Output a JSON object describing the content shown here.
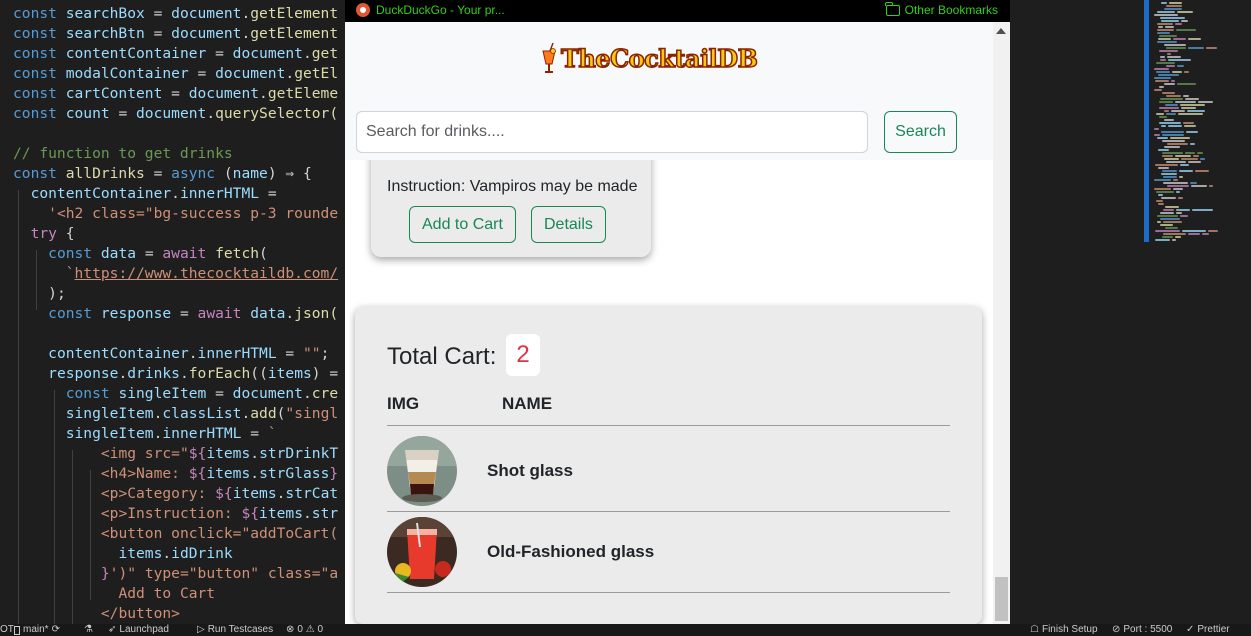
{
  "editor": {
    "lines": [
      [
        {
          "t": "const ",
          "c": "kw"
        },
        {
          "t": "searchBox",
          "c": "var"
        },
        {
          "t": " = ",
          "c": ""
        },
        {
          "t": "document",
          "c": "var"
        },
        {
          "t": ".",
          "c": ""
        },
        {
          "t": "getElement",
          "c": "fn"
        }
      ],
      [
        {
          "t": "const ",
          "c": "kw"
        },
        {
          "t": "searchBtn",
          "c": "var"
        },
        {
          "t": " = ",
          "c": ""
        },
        {
          "t": "document",
          "c": "var"
        },
        {
          "t": ".",
          "c": ""
        },
        {
          "t": "getElement",
          "c": "fn"
        }
      ],
      [
        {
          "t": "const ",
          "c": "kw"
        },
        {
          "t": "contentContainer",
          "c": "var"
        },
        {
          "t": " = ",
          "c": ""
        },
        {
          "t": "document",
          "c": "var"
        },
        {
          "t": ".",
          "c": ""
        },
        {
          "t": "get",
          "c": "fn"
        }
      ],
      [
        {
          "t": "const ",
          "c": "kw"
        },
        {
          "t": "modalContainer",
          "c": "var"
        },
        {
          "t": " = ",
          "c": ""
        },
        {
          "t": "document",
          "c": "var"
        },
        {
          "t": ".",
          "c": ""
        },
        {
          "t": "getEl",
          "c": "fn"
        }
      ],
      [
        {
          "t": "const ",
          "c": "kw"
        },
        {
          "t": "cartContent",
          "c": "var"
        },
        {
          "t": " = ",
          "c": ""
        },
        {
          "t": "document",
          "c": "var"
        },
        {
          "t": ".",
          "c": ""
        },
        {
          "t": "getEleme",
          "c": "fn"
        }
      ],
      [
        {
          "t": "const ",
          "c": "kw"
        },
        {
          "t": "count",
          "c": "var"
        },
        {
          "t": " = ",
          "c": ""
        },
        {
          "t": "document",
          "c": "var"
        },
        {
          "t": ".",
          "c": ""
        },
        {
          "t": "querySelector(",
          "c": "fn"
        }
      ],
      [],
      [
        {
          "t": "// function to get drinks",
          "c": "cm"
        }
      ],
      [
        {
          "t": "const ",
          "c": "kw"
        },
        {
          "t": "allDrinks",
          "c": "fn"
        },
        {
          "t": " = ",
          "c": ""
        },
        {
          "t": "async ",
          "c": "kw"
        },
        {
          "t": "(",
          "c": ""
        },
        {
          "t": "name",
          "c": "var"
        },
        {
          "t": ") ⇒ {",
          "c": ""
        }
      ],
      [
        {
          "t": "  "
        },
        {
          "t": "contentContainer",
          "c": "var"
        },
        {
          "t": ".",
          "c": ""
        },
        {
          "t": "innerHTML",
          "c": "var"
        },
        {
          "t": " =",
          "c": ""
        }
      ],
      [
        {
          "t": "    "
        },
        {
          "t": "'<h2 class=\"bg-success p-3 rounde",
          "c": "str"
        }
      ],
      [
        {
          "t": "  "
        },
        {
          "t": "try ",
          "c": "ctl"
        },
        {
          "t": "{",
          "c": ""
        }
      ],
      [
        {
          "t": "    "
        },
        {
          "t": "const ",
          "c": "kw"
        },
        {
          "t": "data",
          "c": "var"
        },
        {
          "t": " = ",
          "c": ""
        },
        {
          "t": "await ",
          "c": "ctl"
        },
        {
          "t": "fetch",
          "c": "fn"
        },
        {
          "t": "(",
          "c": ""
        }
      ],
      [
        {
          "t": "      "
        },
        {
          "t": "`",
          "c": "str"
        },
        {
          "t": "https://www.thecocktaildb.com/",
          "c": "url"
        }
      ],
      [
        {
          "t": "    "
        },
        {
          "t": ");",
          "c": ""
        }
      ],
      [
        {
          "t": "    "
        },
        {
          "t": "const ",
          "c": "kw"
        },
        {
          "t": "response",
          "c": "var"
        },
        {
          "t": " = ",
          "c": ""
        },
        {
          "t": "await ",
          "c": "ctl"
        },
        {
          "t": "data",
          "c": "var"
        },
        {
          "t": ".",
          "c": ""
        },
        {
          "t": "json(",
          "c": "fn"
        }
      ],
      [],
      [
        {
          "t": "    "
        },
        {
          "t": "contentContainer",
          "c": "var"
        },
        {
          "t": ".",
          "c": ""
        },
        {
          "t": "innerHTML",
          "c": "var"
        },
        {
          "t": " = ",
          "c": ""
        },
        {
          "t": "\"\"",
          "c": "str"
        },
        {
          "t": ";",
          "c": ""
        }
      ],
      [
        {
          "t": "    "
        },
        {
          "t": "response",
          "c": "var"
        },
        {
          "t": ".",
          "c": ""
        },
        {
          "t": "drinks",
          "c": "var"
        },
        {
          "t": ".",
          "c": ""
        },
        {
          "t": "forEach",
          "c": "fn"
        },
        {
          "t": "((",
          "c": ""
        },
        {
          "t": "items",
          "c": "var"
        },
        {
          "t": ") =",
          "c": ""
        }
      ],
      [
        {
          "t": "      "
        },
        {
          "t": "const ",
          "c": "kw"
        },
        {
          "t": "singleItem",
          "c": "var"
        },
        {
          "t": " = ",
          "c": ""
        },
        {
          "t": "document",
          "c": "var"
        },
        {
          "t": ".",
          "c": ""
        },
        {
          "t": "cre",
          "c": "fn"
        }
      ],
      [
        {
          "t": "      "
        },
        {
          "t": "singleItem",
          "c": "var"
        },
        {
          "t": ".",
          "c": ""
        },
        {
          "t": "classList",
          "c": "var"
        },
        {
          "t": ".",
          "c": ""
        },
        {
          "t": "add",
          "c": "fn"
        },
        {
          "t": "(",
          "c": ""
        },
        {
          "t": "\"singl",
          "c": "str"
        }
      ],
      [
        {
          "t": "      "
        },
        {
          "t": "singleItem",
          "c": "var"
        },
        {
          "t": ".",
          "c": ""
        },
        {
          "t": "innerHTML",
          "c": "var"
        },
        {
          "t": " = ",
          "c": ""
        },
        {
          "t": "`",
          "c": "str"
        }
      ],
      [
        {
          "t": "          "
        },
        {
          "t": "<img src=\"",
          "c": "tmpl"
        },
        {
          "t": "${",
          "c": "ctl"
        },
        {
          "t": "items",
          "c": "var"
        },
        {
          "t": ".",
          "c": ""
        },
        {
          "t": "strDrinkT",
          "c": "var"
        }
      ],
      [
        {
          "t": "          "
        },
        {
          "t": "<h4>Name: ",
          "c": "tmpl"
        },
        {
          "t": "${",
          "c": "ctl"
        },
        {
          "t": "items",
          "c": "var"
        },
        {
          "t": ".",
          "c": ""
        },
        {
          "t": "strGlass",
          "c": "var"
        },
        {
          "t": "}",
          "c": "ctl"
        }
      ],
      [
        {
          "t": "          "
        },
        {
          "t": "<p>Category: ",
          "c": "tmpl"
        },
        {
          "t": "${",
          "c": "ctl"
        },
        {
          "t": "items",
          "c": "var"
        },
        {
          "t": ".",
          "c": ""
        },
        {
          "t": "strCat",
          "c": "var"
        }
      ],
      [
        {
          "t": "          "
        },
        {
          "t": "<p>Instruction: ",
          "c": "tmpl"
        },
        {
          "t": "${",
          "c": "ctl"
        },
        {
          "t": "items",
          "c": "var"
        },
        {
          "t": ".",
          "c": ""
        },
        {
          "t": "str",
          "c": "var"
        }
      ],
      [
        {
          "t": "          "
        },
        {
          "t": "<button onclick=\"addToCart(",
          "c": "tmpl"
        }
      ],
      [
        {
          "t": "            "
        },
        {
          "t": "items",
          "c": "var"
        },
        {
          "t": ".",
          "c": ""
        },
        {
          "t": "idDrink",
          "c": "var"
        }
      ],
      [
        {
          "t": "          "
        },
        {
          "t": "}",
          "c": "ctl"
        },
        {
          "t": "')\" type=\"button\" class=\"a",
          "c": "tmpl"
        }
      ],
      [
        {
          "t": "            "
        },
        {
          "t": "Add to Cart",
          "c": "tmpl"
        }
      ],
      [
        {
          "t": "          "
        },
        {
          "t": "</button>",
          "c": "tmpl"
        }
      ]
    ]
  },
  "statusbar": {
    "left_edge": "OT",
    "branch": "main*",
    "launchpad": "Launchpad",
    "run_testcases": "Run Testcases",
    "problems": "0 ⚠ 0",
    "finish_setup": "Finish Setup",
    "port": "Port : 5500",
    "prettier": "Prettier"
  },
  "browser": {
    "tab_title": "DuckDuckGo - Your pr...",
    "other_bookmarks": "Other Bookmarks",
    "logo_text": "TheCocktailDB",
    "search": {
      "placeholder": "Search for drinks....",
      "value": "",
      "button_label": "Search"
    },
    "drink_card": {
      "instruction": "Instruction: Vampiros may be made",
      "add_to_cart_label": "Add to Cart",
      "details_label": "Details"
    },
    "cart": {
      "title": "Total Cart:",
      "count": "2",
      "columns": [
        "IMG",
        "NAME"
      ],
      "items": [
        {
          "name": "Shot glass",
          "image": "layered-shot-drink-photo"
        },
        {
          "name": "Old-Fashioned glass",
          "image": "red-cocktail-drink-photo"
        }
      ]
    }
  },
  "colors": {
    "accent": "#198754",
    "count_color": "#dc3545",
    "bookmark_text": "#33d017"
  }
}
